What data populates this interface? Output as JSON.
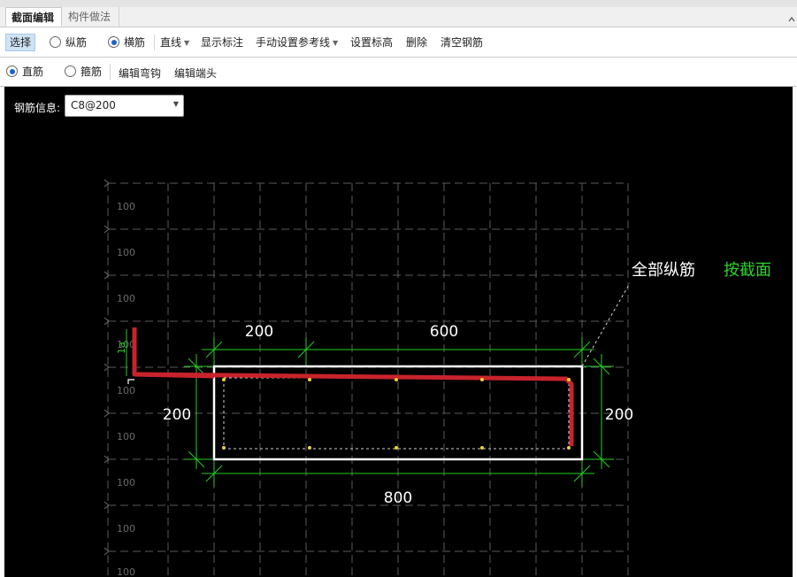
{
  "tabs": [
    "截面编辑",
    "构件做法"
  ],
  "toolbar1": {
    "select": "选择",
    "longitudinal": "纵筋",
    "transverse": "横筋",
    "line_mode": "直线",
    "show_dims": "显示标注",
    "manual_ref": "手动设置参考线",
    "set_elevation": "设置标高",
    "delete": "删除",
    "clear_rebar": "清空钢筋"
  },
  "toolbar2": {
    "straight": "直筋",
    "stirrup": "箍筋",
    "edit_hook": "编辑弯钩",
    "edit_end": "编辑端头"
  },
  "rebar_info": {
    "label": "钢筋信息:",
    "value": "C8@200"
  },
  "drawing": {
    "grid_label": "100",
    "dims": {
      "top_left": "200",
      "top_right": "600",
      "left": "200",
      "right": "200",
      "bottom": "800"
    },
    "hook_label": "1a",
    "annot_all": "全部纵筋",
    "annot_section": "按截面"
  },
  "colors": {
    "rebar": "#c8232c",
    "dimension": "#24d024",
    "outline": "#ffffff",
    "section_text": "#2fd12f"
  }
}
